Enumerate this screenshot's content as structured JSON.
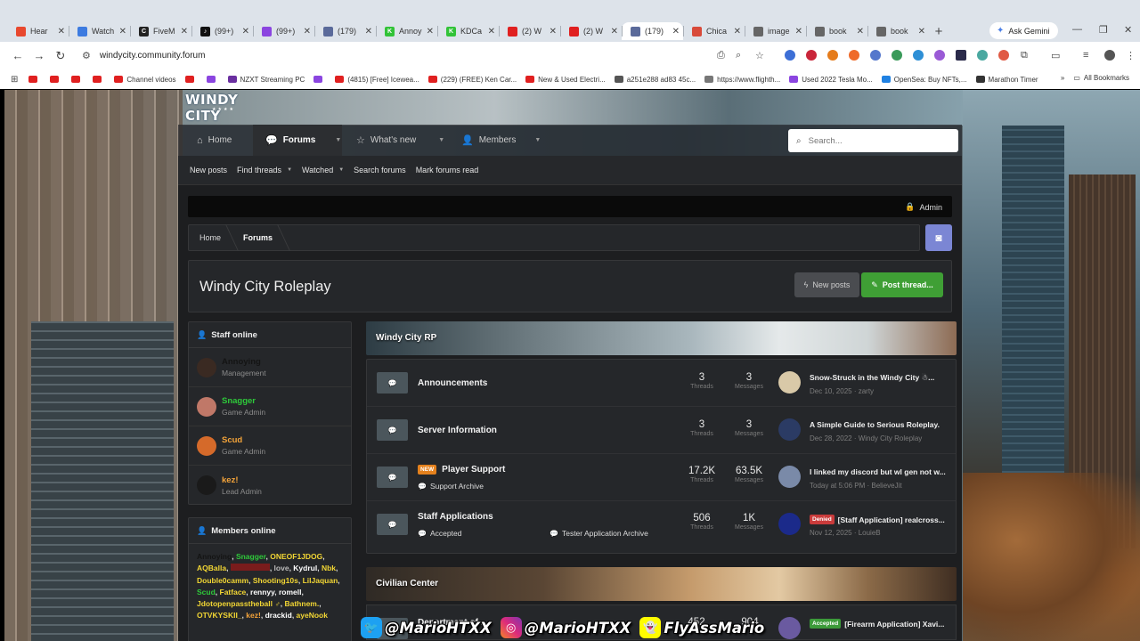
{
  "browser": {
    "tabs": [
      {
        "label": "Hear",
        "color": "#e8482e",
        "glyph": ""
      },
      {
        "label": "Watch",
        "color": "#3d7be0",
        "glyph": ""
      },
      {
        "label": "FiveM",
        "color": "#222222",
        "glyph": "C"
      },
      {
        "label": "(99+)",
        "color": "#111111",
        "glyph": "♪"
      },
      {
        "label": "(99+)",
        "color": "#8b45e0",
        "glyph": ""
      },
      {
        "label": "(179)",
        "color": "#5a6a9a",
        "glyph": ""
      },
      {
        "label": "Annoy",
        "color": "#32c338",
        "glyph": "K"
      },
      {
        "label": "KDCa",
        "color": "#32c338",
        "glyph": "K"
      },
      {
        "label": "(2) W",
        "color": "#e02020",
        "glyph": ""
      },
      {
        "label": "(2) W",
        "color": "#e02020",
        "glyph": ""
      },
      {
        "label": "(179)",
        "color": "#5a6a9a",
        "glyph": ""
      },
      {
        "label": "Chica",
        "color": "#d84a3a",
        "glyph": ""
      },
      {
        "label": "image",
        "color": "#666666",
        "glyph": ""
      },
      {
        "label": "book",
        "color": "#666666",
        "glyph": ""
      },
      {
        "label": "book",
        "color": "#666666",
        "glyph": ""
      }
    ],
    "active_tab": 10,
    "ask_gemini": "Ask Gemini",
    "url": "windycity.community.forum",
    "bookmarks": [
      {
        "label": "",
        "color": "#e02020"
      },
      {
        "label": "",
        "color": "#e02020"
      },
      {
        "label": "",
        "color": "#e02020"
      },
      {
        "label": "",
        "color": "#e02020"
      },
      {
        "label": "Channel videos",
        "color": "#e02020"
      },
      {
        "label": "",
        "color": "#e02020"
      },
      {
        "label": "",
        "color": "#8b45e0"
      },
      {
        "label": "NZXT Streaming PC",
        "color": "#6a2fa0"
      },
      {
        "label": "",
        "color": "#8b45e0"
      },
      {
        "label": "(4815) [Free] Icewea...",
        "color": "#e02020"
      },
      {
        "label": "(229) (FREE) Ken Car...",
        "color": "#e02020"
      },
      {
        "label": "New & Used Electri...",
        "color": "#e02020"
      },
      {
        "label": "a251e288 ad83 45c...",
        "color": "#555555"
      },
      {
        "label": "https://www.flighth...",
        "color": "#777777"
      },
      {
        "label": "Used 2022 Tesla Mo...",
        "color": "#8b45e0"
      },
      {
        "label": "OpenSea: Buy NFTs,...",
        "color": "#2081e2"
      },
      {
        "label": "Marathon Timer",
        "color": "#333333"
      }
    ],
    "all_bookmarks": "All Bookmarks"
  },
  "site": {
    "logo": "WINDY CITY",
    "nav": {
      "home": "Home",
      "forums": "Forums",
      "whats_new": "What's new",
      "members": "Members"
    },
    "search_placeholder": "Search...",
    "subnav": [
      "New posts",
      "Find threads",
      "Watched",
      "Search forums",
      "Mark forums read"
    ],
    "admin": "Admin",
    "breadcrumb": [
      "Home",
      "Forums"
    ],
    "page_title": "Windy City Roleplay",
    "btn_new_posts": "New posts",
    "btn_post_thread": "Post thread..."
  },
  "sidebar": {
    "staff_title": "Staff online",
    "staff": [
      {
        "name": "Annoying",
        "role": "Management",
        "color": "#141414",
        "avatar": "#3a2a22"
      },
      {
        "name": "Snagger",
        "role": "Game Admin",
        "color": "#2ec93a",
        "avatar": "#c07868"
      },
      {
        "name": "Scud",
        "role": "Game Admin",
        "color": "#f4a43a",
        "avatar": "#d56a2a"
      },
      {
        "name": "kez!",
        "role": "Lead Admin",
        "color": "#f4a43a",
        "avatar": "#1a1a1a"
      }
    ],
    "members_title": "Members online",
    "members": [
      {
        "name": "Annoying",
        "color": "#141414"
      },
      {
        "name": "Snagger",
        "color": "#2ec93a"
      },
      {
        "name": "ONEOF1JDOG",
        "color": "#f2d634"
      },
      {
        "name": "AQBalla",
        "color": "#f2d634"
      },
      {
        "name": "",
        "color": "#7a1c1c"
      },
      {
        "name": "love",
        "color": "#bbbbbb"
      },
      {
        "name": "Kydrul",
        "color": "#ffffff"
      },
      {
        "name": "Nbk",
        "color": "#f2d634"
      },
      {
        "name": "Double0camm",
        "color": "#f2d634"
      },
      {
        "name": "Shooting10s",
        "color": "#f2d634"
      },
      {
        "name": "LilJaquan",
        "color": "#f2d634"
      },
      {
        "name": "Scud",
        "color": "#2ec93a"
      },
      {
        "name": "Fatface",
        "color": "#f2d634"
      },
      {
        "name": "rennyy",
        "color": "#ffffff"
      },
      {
        "name": "romell",
        "color": "#ffffff"
      },
      {
        "name": "Jdotopenpasstheball ♂",
        "color": "#f2d634"
      },
      {
        "name": "Bathnem.",
        "color": "#f2d634"
      },
      {
        "name": "OTVKYSKII_",
        "color": "#f2d634"
      },
      {
        "name": "kez!",
        "color": "#f4a43a"
      },
      {
        "name": "drackid",
        "color": "#ffffff"
      },
      {
        "name": "ayeNook",
        "color": "#f2d634"
      }
    ]
  },
  "forum": {
    "category1": "Windy City RP",
    "category2": "Civilian Center",
    "rows": [
      {
        "title": "Announcements",
        "threads": "3",
        "messages": "3",
        "latest": "Snow-Struck in the Windy City ☃...",
        "meta": "Dec 10, 2025 · zarty",
        "avatar": "#d9c9a8",
        "badge": "",
        "sub": "",
        "sub2": "",
        "prefix": ""
      },
      {
        "title": "Server Information",
        "threads": "3",
        "messages": "3",
        "latest": "A Simple Guide to Serious Roleplay.",
        "meta": "Dec 28, 2022 · Windy City Roleplay",
        "avatar": "#2b3b64",
        "badge": "",
        "sub": "",
        "sub2": "",
        "prefix": ""
      },
      {
        "title": "Player Support",
        "threads": "17.2K",
        "messages": "63.5K",
        "latest": "I linked my discord but wl gen not w...",
        "meta": "Today at 5:06 PM · BelieveJit",
        "avatar": "#7a8aa8",
        "badge": "NEW",
        "sub": "Support Archive",
        "sub2": "",
        "prefix": ""
      },
      {
        "title": "Staff Applications",
        "threads": "506",
        "messages": "1K",
        "latest": "[Staff Application] realcross...",
        "meta": "Nov 12, 2025 · LouieB",
        "avatar": "#1b2a8a",
        "badge": "",
        "sub": "Accepted",
        "sub2": "Tester Application Archive",
        "prefix": "Denied"
      }
    ],
    "stat_threads": "Threads",
    "stat_messages": "Messages",
    "row5": {
      "title": "Department of ...",
      "threads": "452",
      "messages": "904",
      "prefix": "Accepted",
      "latest": "[Firearm Application] Xavi..."
    }
  },
  "overlay": {
    "twitter": "@MarioHTXX",
    "instagram": "@MarioHTXX",
    "snapchat": "FlyAssMario"
  }
}
